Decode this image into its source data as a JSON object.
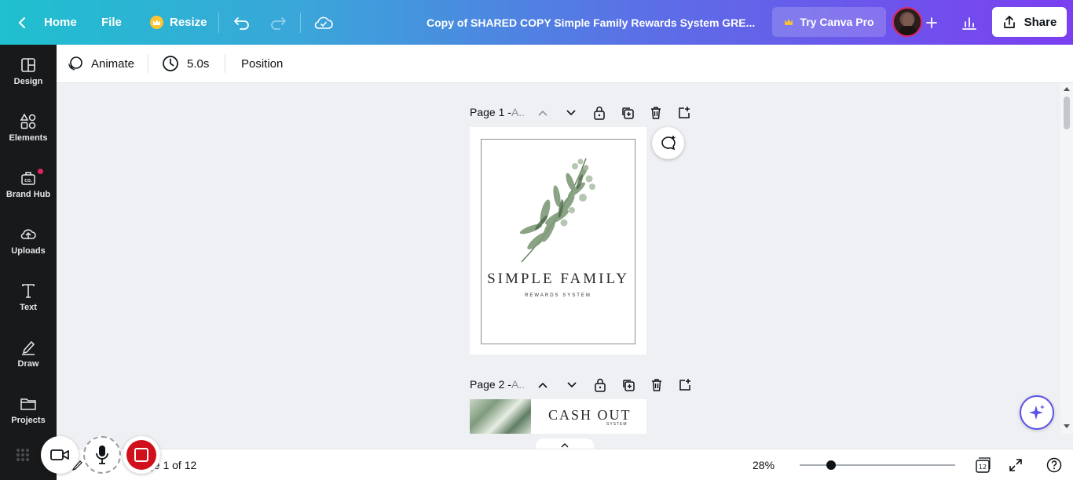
{
  "header": {
    "home_label": "Home",
    "file_label": "File",
    "resize_label": "Resize",
    "doc_title": "Copy of SHARED COPY Simple Family Rewards System GRE...",
    "try_pro_label": "Try Canva Pro",
    "share_label": "Share"
  },
  "sidebar": {
    "items": [
      {
        "label": "Design",
        "icon": "design-icon"
      },
      {
        "label": "Elements",
        "icon": "elements-icon"
      },
      {
        "label": "Brand Hub",
        "icon": "brand-hub-icon"
      },
      {
        "label": "Uploads",
        "icon": "uploads-icon"
      },
      {
        "label": "Text",
        "icon": "text-icon"
      },
      {
        "label": "Draw",
        "icon": "draw-icon"
      },
      {
        "label": "Projects",
        "icon": "projects-icon"
      }
    ]
  },
  "toolbar": {
    "animate_label": "Animate",
    "duration_label": "5.0s",
    "position_label": "Position"
  },
  "pages": [
    {
      "label": "Page 1 - ",
      "name": "A..",
      "title": "SIMPLE FAMILY",
      "subtitle": "REWARDS SYSTEM"
    },
    {
      "label": "Page 2 - ",
      "name": "A..",
      "title": "CASH OUT",
      "subtitle": "SYSTEM"
    }
  ],
  "footer": {
    "page_indicator": "ge 1 of 12",
    "zoom_label": "28%",
    "zoom_level_percent": 28,
    "page_count_badge": "12"
  },
  "colors": {
    "accent_purple": "#7b3ff0",
    "accent_teal": "#1fc0cf",
    "record_red": "#d0101b"
  }
}
